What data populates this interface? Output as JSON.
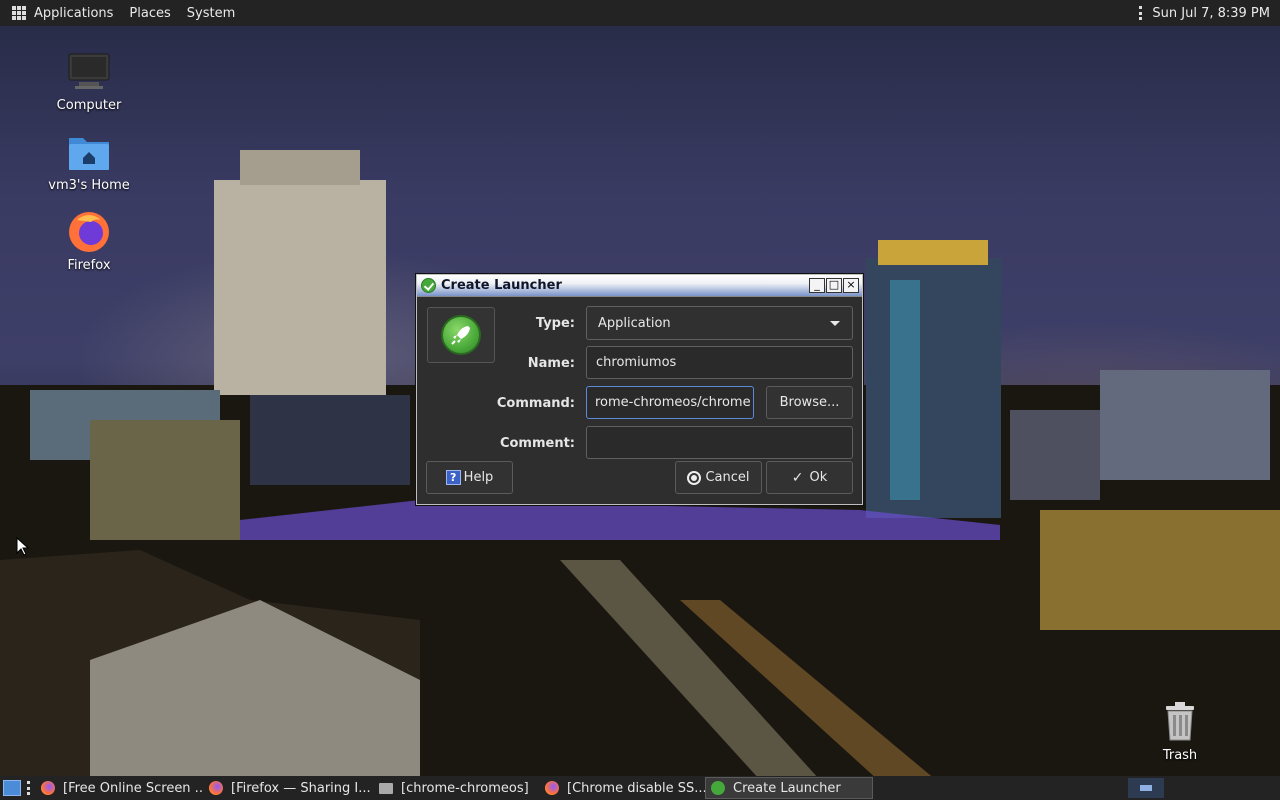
{
  "top_panel": {
    "menus": [
      "Applications",
      "Places",
      "System"
    ],
    "clock": "Sun Jul  7,  8:39 PM"
  },
  "desktop_icons": [
    {
      "label": "Computer",
      "icon": "computer-icon"
    },
    {
      "label": "vm3's Home",
      "icon": "home-folder-icon"
    },
    {
      "label": "Firefox",
      "icon": "firefox-icon"
    }
  ],
  "trash": {
    "label": "Trash",
    "icon": "trash-icon"
  },
  "dialog": {
    "title": "Create Launcher",
    "window_buttons": [
      "_",
      "□",
      "×"
    ],
    "type_label": "Type:",
    "type_value": "Application",
    "name_label": "Name:",
    "name_value": "chromiumos",
    "command_label": "Command:",
    "command_value": "rome-chromeos/chrome",
    "comment_label": "Comment:",
    "comment_value": "",
    "browse_label": "Browse...",
    "help_label": "Help",
    "cancel_label": "Cancel",
    "ok_label": "Ok",
    "help_icon_glyph": "?",
    "ok_icon_glyph": "✓"
  },
  "taskbar": {
    "tasks": [
      {
        "label": "[Free Online Screen ...",
        "icon": "firefox-icon",
        "active": false
      },
      {
        "label": "[Firefox — Sharing I...",
        "icon": "firefox-icon",
        "active": false
      },
      {
        "label": "[chrome-chromeos]",
        "icon": "folder-icon",
        "active": false
      },
      {
        "label": "[Chrome disable SS...",
        "icon": "firefox-icon",
        "active": false
      },
      {
        "label": "Create Launcher",
        "icon": "launcher-icon",
        "active": true
      }
    ]
  },
  "colors": {
    "panel": "#232323",
    "dialog_bg": "#2e2e2e",
    "focus_border": "#5a8ad8",
    "titlebar_blue": "#7a93c9"
  }
}
